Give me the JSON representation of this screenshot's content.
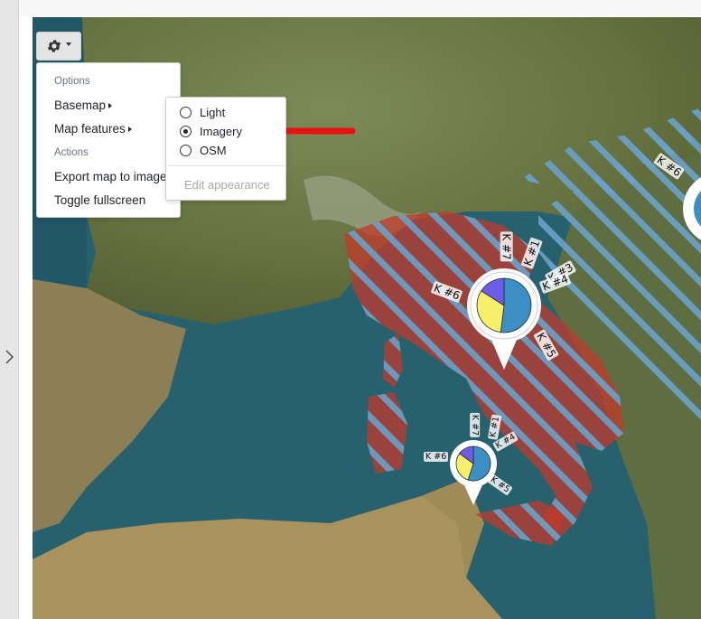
{
  "menu": {
    "options_header": "Options",
    "basemap": "Basemap",
    "map_features": "Map features",
    "actions_header": "Actions",
    "export": "Export map to image",
    "fullscreen": "Toggle fullscreen"
  },
  "basemap_submenu": {
    "options": [
      "Light",
      "Imagery",
      "OSM"
    ],
    "selected": "Imagery",
    "edit_appearance": "Edit appearance"
  },
  "cluster_labels": {
    "big": [
      "K #7",
      "K #1",
      "K #6",
      "K #3",
      "K #4",
      "K #5"
    ],
    "small": [
      "K #7",
      "K #1",
      "K #4",
      "K #6",
      "K #5"
    ],
    "edge": "K #6"
  },
  "pie_charts": {
    "big": [
      {
        "color": "#3b8fc4",
        "fraction": 0.52
      },
      {
        "color": "#f5ef6a",
        "fraction": 0.32
      },
      {
        "color": "#6c5ce7",
        "fraction": 0.16
      }
    ],
    "small": [
      {
        "color": "#3b8fc4",
        "fraction": 0.55
      },
      {
        "color": "#f5ef6a",
        "fraction": 0.3
      },
      {
        "color": "#6c5ce7",
        "fraction": 0.15
      }
    ]
  },
  "colors": {
    "sea": "#27616e",
    "land": "#6f7c4e",
    "hatch_red": "#c0392b",
    "hatch_blue": "#6aa2c9",
    "arrow": "#e8130f"
  }
}
